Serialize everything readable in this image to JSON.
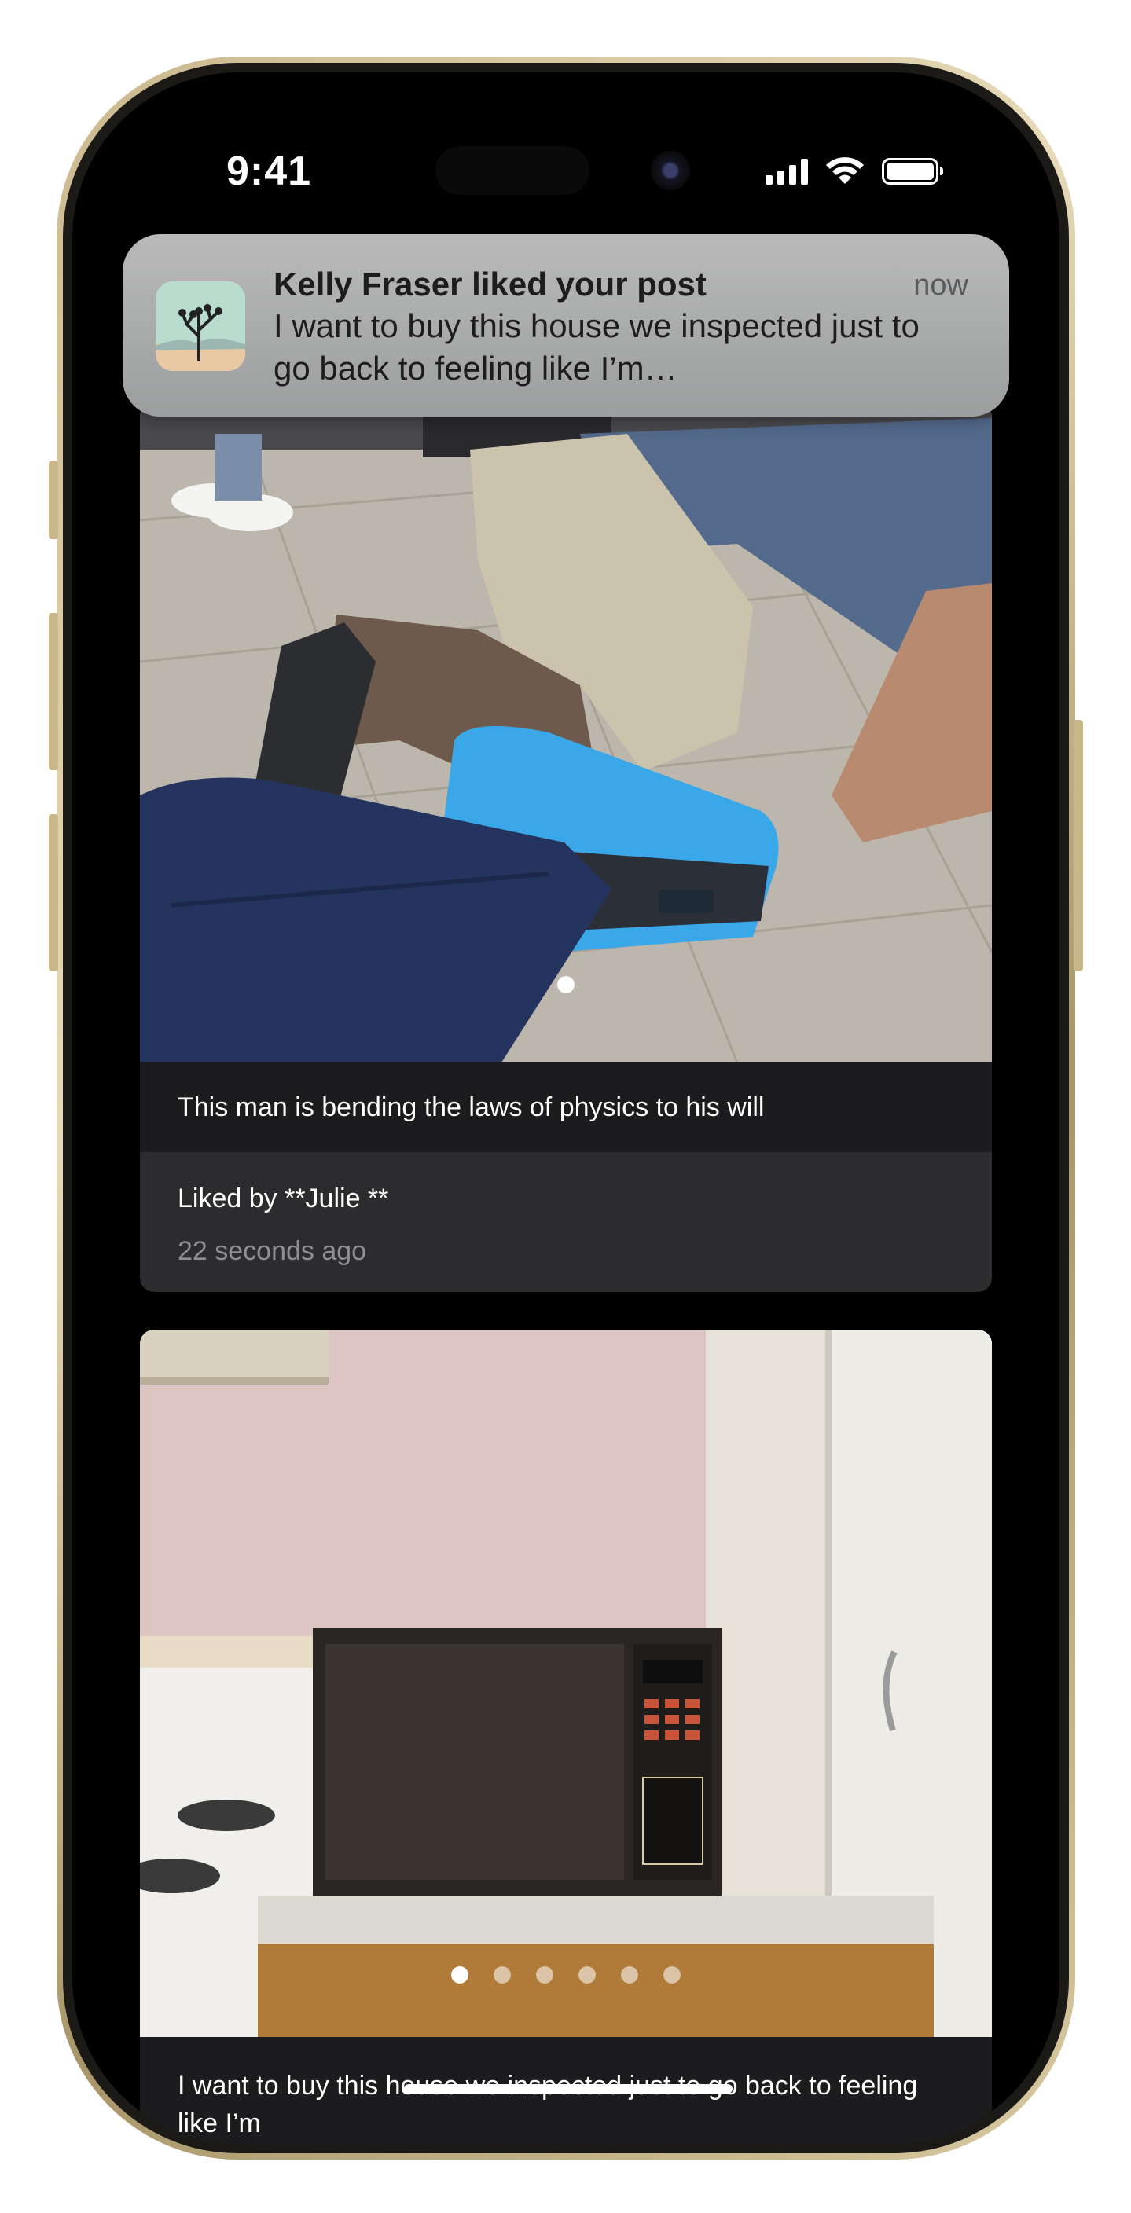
{
  "status_bar": {
    "time": "9:41"
  },
  "notification": {
    "title": "Kelly Fraser liked your post",
    "time": "now",
    "body": "I want to buy this house we inspected just to go back to feeling like I’m…",
    "app_icon": "joshua-tree-icon"
  },
  "posts": [
    {
      "image": "airport-man-sitting-on-blue-suitcase",
      "caption": "This man is bending the laws of physics to his will",
      "liked_by": "Liked by **Julie **",
      "timestamp": "22 seconds ago",
      "page_count": 1,
      "current_page": 1
    },
    {
      "image": "kitchen-with-vintage-microwave",
      "caption": "I want to buy this house we inspected just to go back to feeling like I’m",
      "page_count": 6,
      "current_page": 1
    }
  ],
  "colors": {
    "card_bg": "#2c2c2e",
    "caption_bg": "#1c1c1e",
    "notification_bg": "#b0b1b1",
    "suitcase_blue": "#3aa8e8"
  }
}
